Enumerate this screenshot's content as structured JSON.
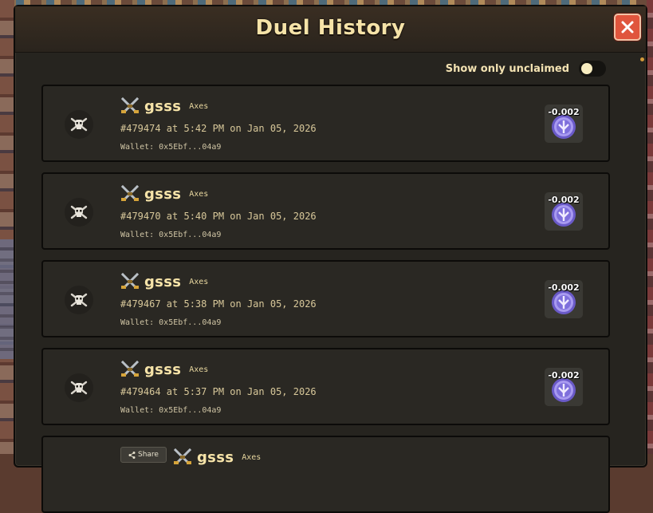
{
  "modal": {
    "title": "Duel History",
    "toggle_label": "Show only unclaimed",
    "toggle_on": false
  },
  "duels": [
    {
      "opponent": "gsss",
      "weapon": "Axes",
      "meta": "#479474 at 5:42 PM on Jan 05, 2026",
      "wallet": "Wallet: 0x5Ebf...04a9",
      "reward": "-0.002"
    },
    {
      "opponent": "gsss",
      "weapon": "Axes",
      "meta": "#479470 at 5:40 PM on Jan 05, 2026",
      "wallet": "Wallet: 0x5Ebf...04a9",
      "reward": "-0.002"
    },
    {
      "opponent": "gsss",
      "weapon": "Axes",
      "meta": "#479467 at 5:38 PM on Jan 05, 2026",
      "wallet": "Wallet: 0x5Ebf...04a9",
      "reward": "-0.002"
    },
    {
      "opponent": "gsss",
      "weapon": "Axes",
      "meta": "#479464 at 5:37 PM on Jan 05, 2026",
      "wallet": "Wallet: 0x5Ebf...04a9",
      "reward": "-0.002"
    },
    {
      "opponent": "gsss",
      "weapon": "Axes",
      "share_label": "Share"
    }
  ],
  "colors": {
    "accent_title": "#f6e3a8",
    "close_button": "#e0553d",
    "coin": "#8a7ad8"
  },
  "icons": {
    "close": "close-icon",
    "avatar": "skull-crossbones-icon",
    "duel": "crossed-swords-icon",
    "reward": "purple-coin-icon",
    "share": "share-icon"
  }
}
